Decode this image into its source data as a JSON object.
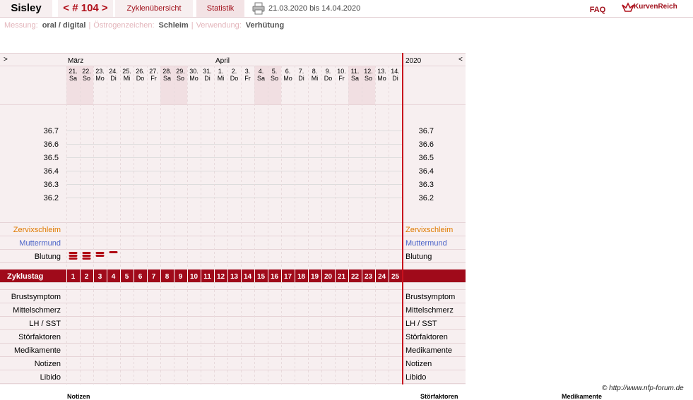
{
  "header": {
    "name": "Sisley",
    "cycle": "< # 104 >",
    "overview": "Zyklenübersicht",
    "stats": "Statistik",
    "range": "21.03.2020 bis 14.04.2020",
    "faq": "FAQ",
    "brand": "KurvenReich"
  },
  "info": {
    "measure_label": "Messung:",
    "measure_value": "oral / digital",
    "sign_label": "Östrogenzeichen:",
    "sign_value": "Schleim",
    "use_label": "Verwendung:",
    "use_value": "Verhütung"
  },
  "grid": {
    "left_arrow": ">",
    "right_arrow": "<",
    "year": "2020",
    "month_march": "März",
    "month_april": "April",
    "days": [
      {
        "d": "21.",
        "w": "Sa",
        "we": true
      },
      {
        "d": "22.",
        "w": "So",
        "we": true
      },
      {
        "d": "23.",
        "w": "Mo",
        "we": false
      },
      {
        "d": "24.",
        "w": "Di",
        "we": false
      },
      {
        "d": "25.",
        "w": "Mi",
        "we": false
      },
      {
        "d": "26.",
        "w": "Do",
        "we": false
      },
      {
        "d": "27.",
        "w": "Fr",
        "we": false
      },
      {
        "d": "28.",
        "w": "Sa",
        "we": true
      },
      {
        "d": "29.",
        "w": "So",
        "we": true
      },
      {
        "d": "30.",
        "w": "Mo",
        "we": false
      },
      {
        "d": "31.",
        "w": "Di",
        "we": false
      },
      {
        "d": "1.",
        "w": "Mi",
        "we": false
      },
      {
        "d": "2.",
        "w": "Do",
        "we": false
      },
      {
        "d": "3.",
        "w": "Fr",
        "we": false
      },
      {
        "d": "4.",
        "w": "Sa",
        "we": true
      },
      {
        "d": "5.",
        "w": "So",
        "we": true
      },
      {
        "d": "6.",
        "w": "Mo",
        "we": false
      },
      {
        "d": "7.",
        "w": "Di",
        "we": false
      },
      {
        "d": "8.",
        "w": "Mi",
        "we": false
      },
      {
        "d": "9.",
        "w": "Do",
        "we": false
      },
      {
        "d": "10.",
        "w": "Fr",
        "we": false
      },
      {
        "d": "11.",
        "w": "Sa",
        "we": true
      },
      {
        "d": "12.",
        "w": "So",
        "we": true
      },
      {
        "d": "13.",
        "w": "Mo",
        "we": false
      },
      {
        "d": "14.",
        "w": "Di",
        "we": false
      }
    ],
    "temps": [
      "36.7",
      "36.6",
      "36.5",
      "36.4",
      "36.3",
      "36.2"
    ],
    "rows_top": [
      {
        "label": "Zervixschleim",
        "color": "#e07b00"
      },
      {
        "label": "Muttermund",
        "color": "#4a63c8"
      },
      {
        "label": "Blutung",
        "color": "#000000"
      }
    ],
    "cycle_day_label": "Zyklustag",
    "cycle_days": [
      "1",
      "2",
      "3",
      "4",
      "5",
      "6",
      "7",
      "8",
      "9",
      "10",
      "11",
      "12",
      "13",
      "14",
      "15",
      "16",
      "17",
      "18",
      "19",
      "20",
      "21",
      "22",
      "23",
      "24",
      "25"
    ],
    "bleeding": [
      3,
      3,
      2,
      1
    ],
    "rows_bottom": [
      "Brustsymptom",
      "Mittelschmerz",
      "LH / SST",
      "Störfaktoren",
      "Medikamente",
      "Notizen",
      "Libido"
    ]
  },
  "footer": {
    "copyright": "© http://www.nfp-forum.de",
    "notizen": "Notizen",
    "stoerfaktoren": "Störfaktoren",
    "medikamente": "Medikamente"
  },
  "colors": {
    "accent": "#a00a1a",
    "panel": "#f7eff0",
    "weekend": "#f1dfe2"
  }
}
